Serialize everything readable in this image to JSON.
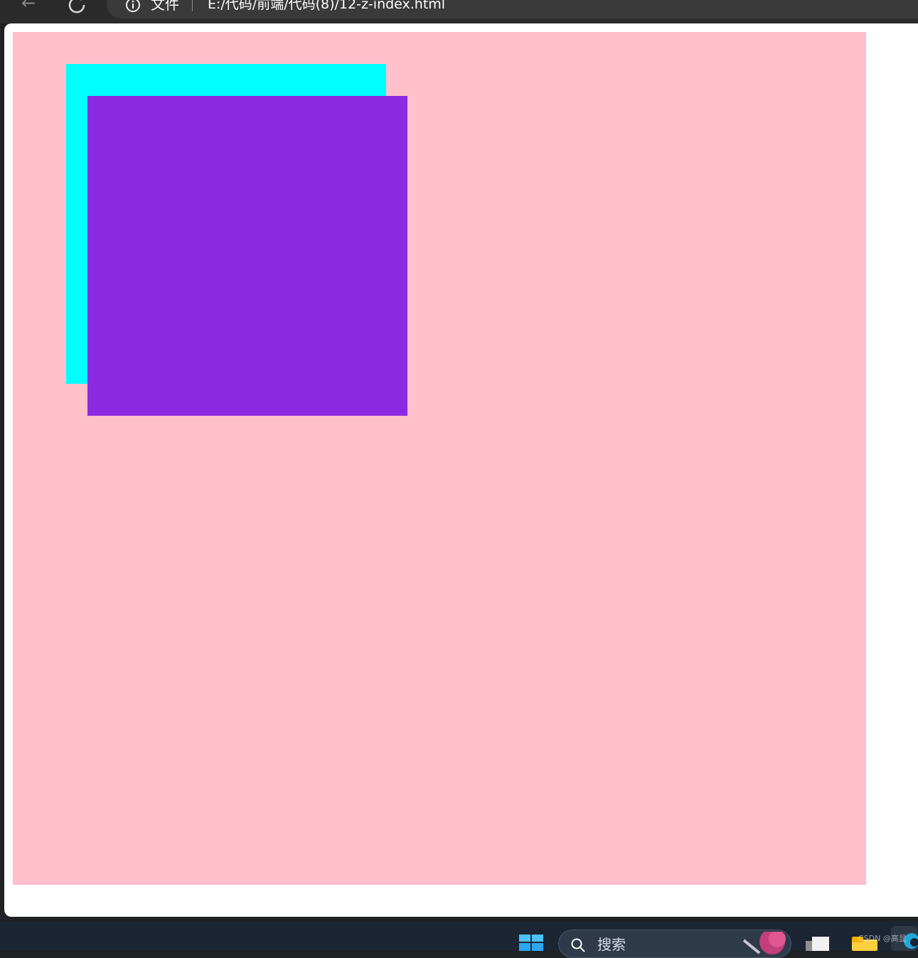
{
  "browser": {
    "address_label": "文件",
    "url": "E:/代码/前端/代码(8)/12-z-index.html"
  },
  "page": {
    "outer_color": "#ffc0cb",
    "box1_color": "#00ffff",
    "box2_color": "#8a2be2"
  },
  "taskbar": {
    "search_label": "搜索",
    "watermark": "CSDN @高显"
  },
  "icons": {
    "back": "arrow-left-icon",
    "reload": "reload-icon",
    "info": "info-icon",
    "start": "windows-start-icon",
    "search": "search-icon",
    "search_art": "search-art-icon",
    "app": "app-icon",
    "folder": "folder-icon",
    "browser": "browser-icon"
  }
}
